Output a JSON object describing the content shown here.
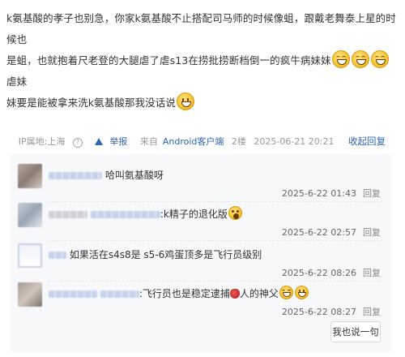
{
  "post": {
    "line1": "k氨基酸的孝子也别急，你家k氨基酸不止搭配司马师的时候像蛆，跟戴老舞泰上星的时候也",
    "line2": "是蛆，也就抱着尺老登的大腿虐了虐s13在捞批捞断档倒一的疯牛病妹妹",
    "line2_tail": "虐妹",
    "line3": "妹要是能被拿来洗k氨基酸那我没话说"
  },
  "meta": {
    "ip": "IP属地:上海",
    "report": "举报",
    "source_prefix": "来自",
    "source_link": "Android客户端",
    "floor": "2楼",
    "time": "2025-06-21 20:21",
    "toggle": "收起回复"
  },
  "replies": [
    {
      "text": "哈叫氨基酸呀",
      "time": "2025-6-22 01:43",
      "reply": "回复"
    },
    {
      "text": ":k精子的退化版",
      "time": "2025-6-22 02:57",
      "reply": "回复"
    },
    {
      "text": "如果活在s4s8是 s5-6鸡蛋顶多是飞行员级别",
      "time": "2025-6-22 08:26",
      "reply": "回复"
    },
    {
      "text": ":飞行员也是稳定逮捕",
      "text_tail": "人的神父",
      "time": "2025-6-22 08:27",
      "reply": "回复"
    }
  ],
  "say_button": "我也说一句",
  "icons": [
    "laugh-emoji-icon",
    "smile-emoji-icon",
    "question-icon",
    "warning-icon",
    "shock-emoji-icon",
    "rose-icon"
  ]
}
